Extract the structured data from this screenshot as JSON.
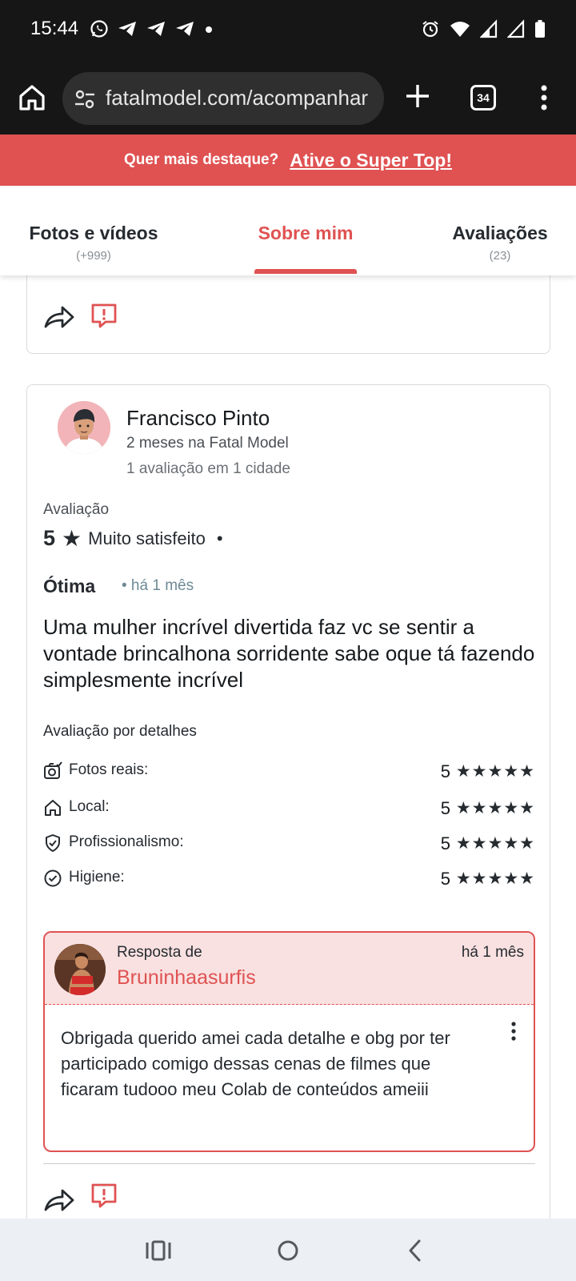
{
  "status_bar": {
    "time": "15:44"
  },
  "browser": {
    "url": "fatalmodel.com/acompanhar",
    "tab_count": "34"
  },
  "promo": {
    "text": "Quer mais destaque?",
    "link": "Ative o Super Top!"
  },
  "tabs": [
    {
      "label": "Fotos e vídeos",
      "count": "(+999)"
    },
    {
      "label": "Sobre mim",
      "count": ""
    },
    {
      "label": "Avaliações",
      "count": "(23)"
    }
  ],
  "review": {
    "reviewer_name": "Francisco Pinto",
    "reviewer_tenure": "2 meses na Fatal Model",
    "reviewer_reviews": "1 avaliação em 1 cidade",
    "rating_label": "Avaliação",
    "rating_score": "5",
    "rating_star": "★",
    "rating_text": "Muito satisfeito",
    "rating_dot": "•",
    "title": "Ótima",
    "time": "• há 1 mês",
    "body": "Uma mulher incrível divertida faz vc se sentir a vontade brincalhona sorridente sabe oque tá fazendo simplesmente incrível",
    "details_label": "Avaliação por detalhes",
    "details": [
      {
        "icon": "camera-check-icon",
        "name": "Fotos reais:",
        "score": "5",
        "stars": "★★★★★"
      },
      {
        "icon": "home-icon",
        "name": "Local:",
        "score": "5",
        "stars": "★★★★★"
      },
      {
        "icon": "shield-check-icon",
        "name": "Profissionalismo:",
        "score": "5",
        "stars": "★★★★★"
      },
      {
        "icon": "check-circle-icon",
        "name": "Higiene:",
        "score": "5",
        "stars": "★★★★★"
      }
    ]
  },
  "reply": {
    "from_label": "Resposta de",
    "author": "Bruninhaasurfis",
    "time": "há 1 mês",
    "body": "Obrigada querido amei cada detalhe e obg por ter participado comigo dessas cenas de filmes que ficaram tudooo meu Colab de conteúdos ameiii"
  },
  "colors": {
    "accent": "#e05252",
    "reply_bg": "#f9e1e1",
    "chrome_bg": "#161616"
  }
}
